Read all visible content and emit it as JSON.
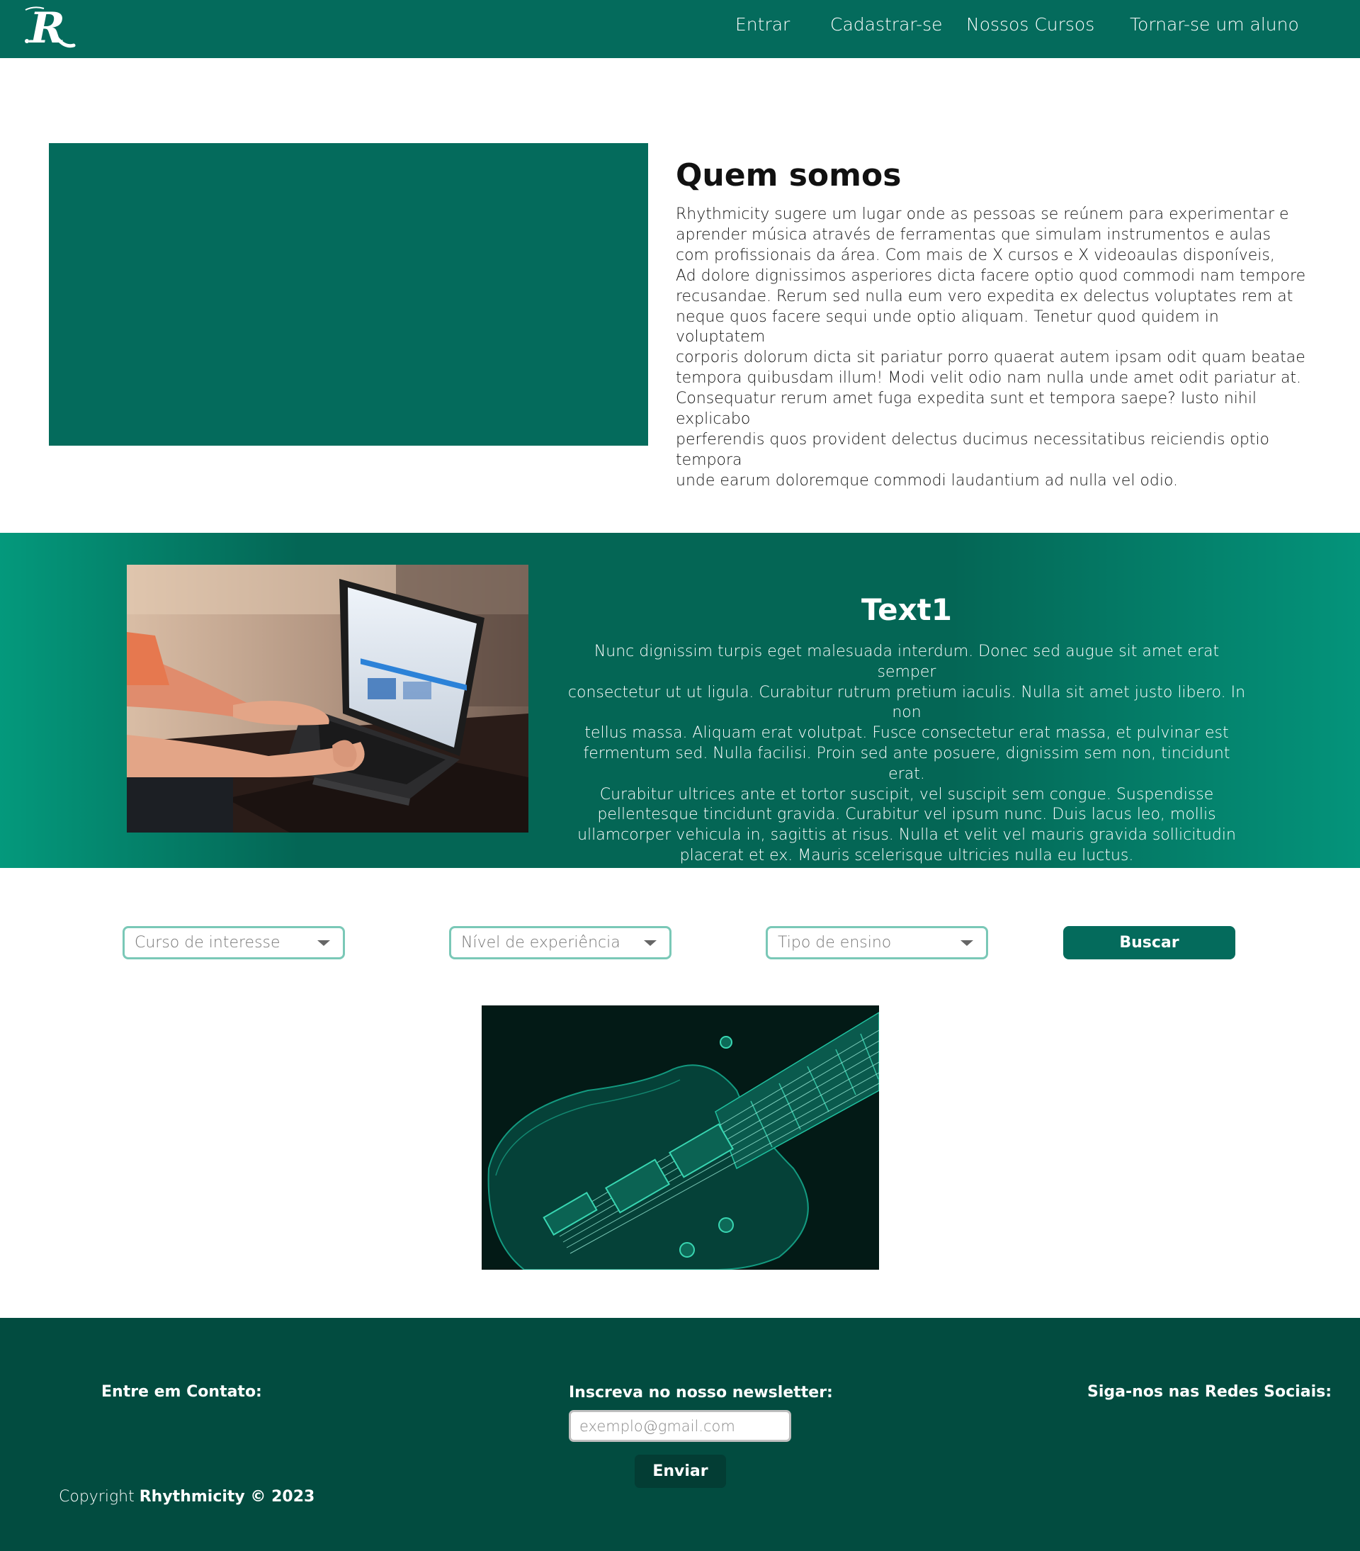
{
  "nav": {
    "logo_letter": "R",
    "links": [
      "Entrar",
      "Cadastrar-se",
      "Nossos Cursos",
      "Tornar-se um aluno"
    ]
  },
  "about": {
    "title": "Quem somos",
    "text": "Rhythmicity sugere um lugar onde as pessoas se reúnem para experimentar e\naprender música através de ferramentas que simulam instrumentos e aulas\ncom profissionais da área. Com mais de X cursos e X videoaulas disponíveis,\nAd dolore dignissimos asperiores dicta facere optio quod commodi nam tempore\nrecusandae. Rerum sed nulla eum vero expedita ex delectus voluptates rem at\nneque quos facere sequi unde optio aliquam. Tenetur quod quidem in voluptatem\ncorporis dolorum dicta sit pariatur porro quaerat autem ipsam odit quam beatae\ntempora quibusdam illum! Modi velit odio nam nulla unde amet odit pariatur at.\nConsequatur rerum amet fuga expedita sunt et tempora saepe? Iusto nihil explicabo\nperferendis quos provident delectus ducimus necessitatibus reiciendis optio tempora\nunde earum doloremque commodi laudantium ad nulla vel odio."
  },
  "feature": {
    "title": "Text1",
    "text": "Nunc dignissim turpis eget malesuada interdum. Donec sed augue sit amet erat semper\nconsectetur ut ut ligula. Curabitur rutrum pretium iaculis. Nulla sit amet justo libero. In non\ntellus massa. Aliquam erat volutpat. Fusce consectetur erat massa, et pulvinar est\nfermentum sed. Nulla facilisi. Proin sed ante posuere, dignissim sem non, tincidunt erat.\nCurabitur ultrices ante et tortor suscipit, vel suscipit sem congue. Suspendisse\npellentesque tincidunt gravida. Curabitur vel ipsum nunc. Duis lacus leo, mollis\nullamcorper vehicula in, sagittis at risus. Nulla et velit vel mauris gravida sollicitudin\nplacerat et ex. Mauris scelerisque ultricies nulla eu luctus."
  },
  "filters": {
    "course": "Curso de interesse",
    "level": "Nível de experiência",
    "type": "Tipo de ensino",
    "search_label": "Buscar"
  },
  "footer": {
    "contact_heading": "Entre em Contato:",
    "newsletter_heading": "Inscreva no nosso newsletter:",
    "newsletter_placeholder": "exemplo@gmail.com",
    "send_label": "Enviar",
    "social_heading": "Siga-nos nas Redes Sociais:",
    "copyright_prefix": "Copyright",
    "copyright_brand": "Rhythmicity © 2023"
  },
  "colors": {
    "primary": "#046b5c",
    "footer": "#024c40",
    "select_border": "#7ac8b7"
  },
  "icons": [
    "logo-r-icon",
    "chevron-down-icon"
  ]
}
